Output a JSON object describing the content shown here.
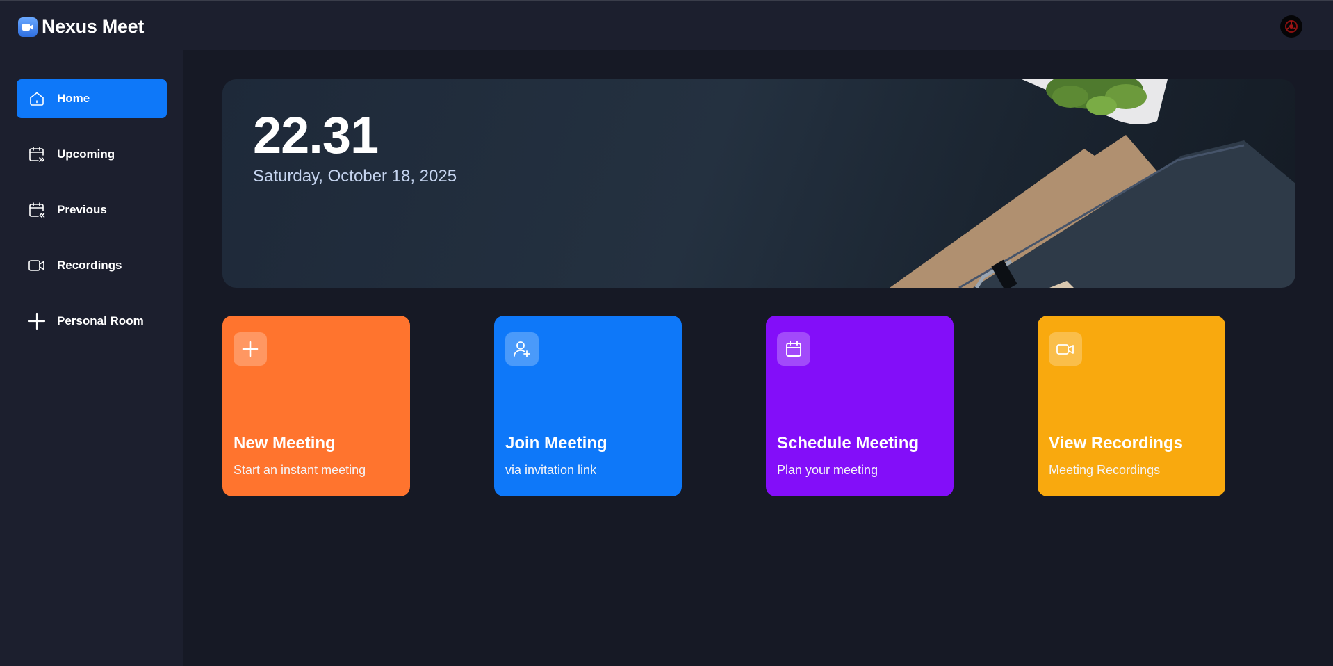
{
  "app": {
    "title": "Nexus Meet"
  },
  "sidebar": {
    "items": [
      {
        "label": "Home",
        "icon": "home-icon",
        "active": true
      },
      {
        "label": "Upcoming",
        "icon": "calendar-upcoming-icon",
        "active": false
      },
      {
        "label": "Previous",
        "icon": "calendar-previous-icon",
        "active": false
      },
      {
        "label": "Recordings",
        "icon": "video-icon",
        "active": false
      },
      {
        "label": "Personal Room",
        "icon": "plus-icon",
        "active": false
      }
    ]
  },
  "hero": {
    "time": "22.31",
    "date": "Saturday, October 18, 2025"
  },
  "cards": [
    {
      "title": "New Meeting",
      "subtitle": "Start an instant meeting",
      "color": "#ff742e",
      "icon": "plus-icon"
    },
    {
      "title": "Join Meeting",
      "subtitle": "via invitation link",
      "color": "#0e78f9",
      "icon": "user-add-icon"
    },
    {
      "title": "Schedule Meeting",
      "subtitle": "Plan your meeting",
      "color": "#830ef9",
      "icon": "calendar-icon"
    },
    {
      "title": "View Recordings",
      "subtitle": "Meeting Recordings",
      "color": "#f9a90e",
      "icon": "video-icon"
    }
  ],
  "colors": {
    "background": "#161925",
    "surface": "#1c1f2e",
    "accent": "#0e78f9"
  }
}
